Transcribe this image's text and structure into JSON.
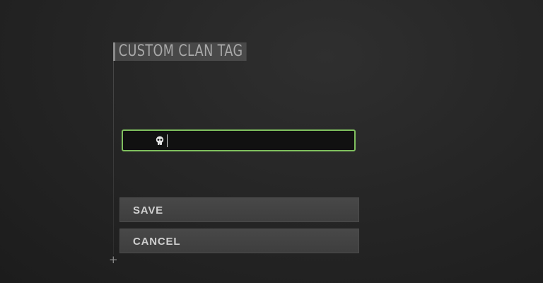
{
  "dialog": {
    "title": "CUSTOM CLAN TAG",
    "input": {
      "value": "",
      "icon": "skull-icon"
    },
    "buttons": {
      "save_label": "SAVE",
      "cancel_label": "CANCEL"
    }
  },
  "colors": {
    "input_border": "#7fbf5e",
    "input_bg": "#111111",
    "button_bg": "#444444",
    "background": "#262626"
  },
  "decorations": {
    "corner_glyph": "+"
  }
}
